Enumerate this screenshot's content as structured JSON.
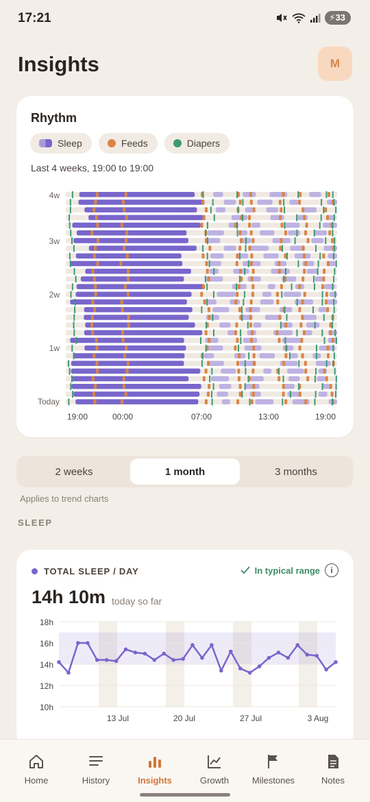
{
  "status": {
    "time": "17:21",
    "battery": "33"
  },
  "header": {
    "title": "Insights",
    "avatar": "M"
  },
  "rhythm": {
    "title": "Rhythm",
    "chips": [
      {
        "label": "Sleep",
        "icon": "sleep-icon",
        "color": "#7866cc"
      },
      {
        "label": "Feeds",
        "icon": "feed-dot",
        "color": "#d98546"
      },
      {
        "label": "Diapers",
        "icon": "diaper-dot",
        "color": "#3d9a72"
      }
    ],
    "subtitle": "Last 4 weeks, 19:00 to 19:00",
    "row_labels": [
      "4w",
      "3w",
      "2w",
      "1w",
      "Today"
    ],
    "time_labels": [
      "19:00",
      "00:00",
      "07:00",
      "13:00",
      "19:00"
    ]
  },
  "range_selector": {
    "options": [
      "2 weeks",
      "1 month",
      "3 months"
    ],
    "selected": "1 month",
    "note": "Applies to trend charts"
  },
  "sleep_section": {
    "label": "SLEEP",
    "metric_title": "TOTAL SLEEP / DAY",
    "status": "In typical range",
    "value": "14h 10m",
    "value_sub": "today so far"
  },
  "chart_data": {
    "type": "line",
    "y_labels": [
      "18h",
      "16h",
      "14h",
      "12h",
      "10h"
    ],
    "ylim": [
      10,
      18
    ],
    "typical_range": [
      14,
      17
    ],
    "x_labels": [
      "13 Jul",
      "20 Jul",
      "27 Jul",
      "3 Aug"
    ],
    "series": [
      {
        "color": "#7866cc",
        "values": [
          14.2,
          13.2,
          16.0,
          16.0,
          14.4,
          14.4,
          14.3,
          15.4,
          15.1,
          15.0,
          14.4,
          15.0,
          14.4,
          14.5,
          15.8,
          14.6,
          15.8,
          13.4,
          15.2,
          13.6,
          13.2,
          13.8,
          14.6,
          15.1,
          14.6,
          15.8,
          14.9,
          14.8,
          13.5,
          14.2
        ]
      }
    ]
  },
  "nav": {
    "items": [
      {
        "label": "Home",
        "icon": "home-icon"
      },
      {
        "label": "History",
        "icon": "history-icon"
      },
      {
        "label": "Insights",
        "icon": "insights-icon"
      },
      {
        "label": "Growth",
        "icon": "growth-icon"
      },
      {
        "label": "Milestones",
        "icon": "flag-icon"
      },
      {
        "label": "Notes",
        "icon": "notes-icon"
      }
    ],
    "active": "Insights"
  }
}
